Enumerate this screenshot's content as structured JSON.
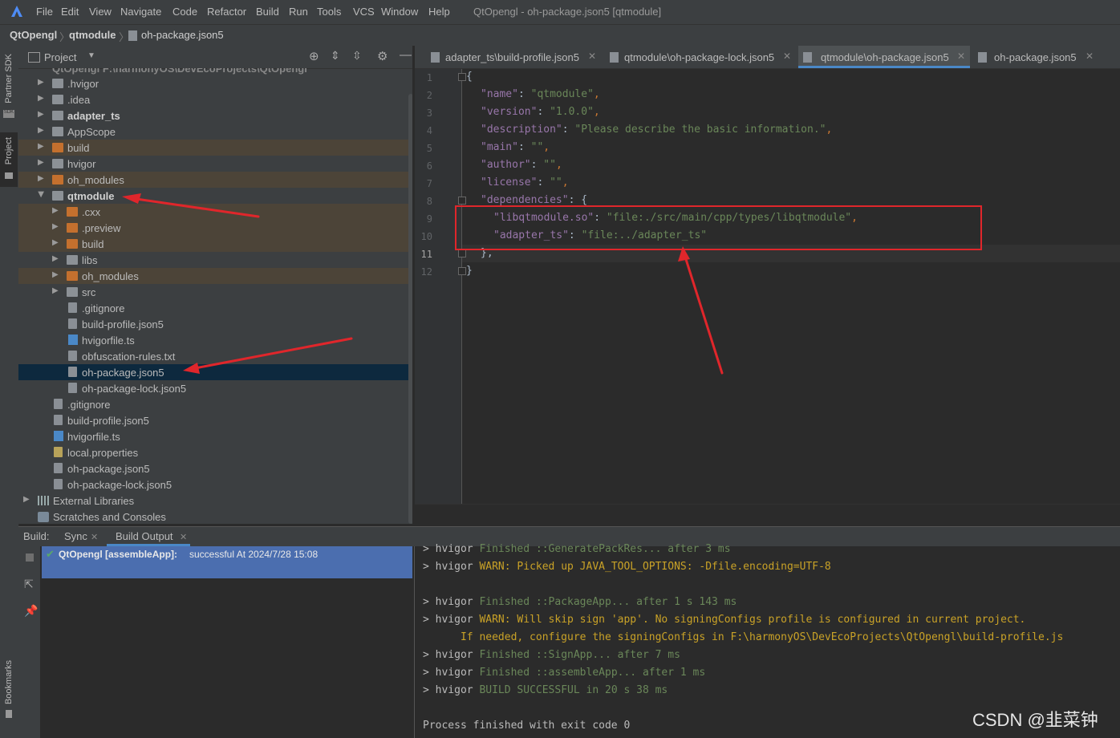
{
  "menubar": {
    "items": [
      "File",
      "Edit",
      "View",
      "Navigate",
      "Code",
      "Refactor",
      "Build",
      "Run",
      "Tools",
      "VCS",
      "Window",
      "Help"
    ],
    "window_title": "QtOpengl - oh-package.json5 [qtmodule]"
  },
  "breadcrumb": {
    "items": [
      "QtOpengl",
      "qtmodule",
      "oh-package.json5"
    ]
  },
  "left_strip": {
    "partner_sdk": "Partner SDK",
    "project": "Project",
    "bookmarks": "Bookmarks"
  },
  "project_panel": {
    "title": "Project",
    "root_partial": "QtOpengl  F:\\harmonyOS\\DevEcoProjects\\QtOpengl",
    "tree": [
      {
        "label": ".hvigor"
      },
      {
        "label": ".idea"
      },
      {
        "label": "adapter_ts"
      },
      {
        "label": "AppScope"
      },
      {
        "label": "build"
      },
      {
        "label": "hvigor"
      },
      {
        "label": "oh_modules"
      },
      {
        "label": "qtmodule"
      },
      {
        "label": ".cxx"
      },
      {
        "label": ".preview"
      },
      {
        "label": "build"
      },
      {
        "label": "libs"
      },
      {
        "label": "oh_modules"
      },
      {
        "label": "src"
      },
      {
        "label": ".gitignore"
      },
      {
        "label": "build-profile.json5"
      },
      {
        "label": "hvigorfile.ts"
      },
      {
        "label": "obfuscation-rules.txt"
      },
      {
        "label": "oh-package.json5"
      },
      {
        "label": "oh-package-lock.json5"
      },
      {
        "label": ".gitignore"
      },
      {
        "label": "build-profile.json5"
      },
      {
        "label": "hvigorfile.ts"
      },
      {
        "label": "local.properties"
      },
      {
        "label": "oh-package.json5"
      },
      {
        "label": "oh-package-lock.json5"
      },
      {
        "label": "External Libraries"
      },
      {
        "label": "Scratches and Consoles"
      }
    ]
  },
  "editor": {
    "tabs": [
      {
        "label": "adapter_ts\\build-profile.json5",
        "active": false
      },
      {
        "label": "qtmodule\\oh-package-lock.json5",
        "active": false
      },
      {
        "label": "qtmodule\\oh-package.json5",
        "active": true
      },
      {
        "label": "oh-package.json5",
        "active": false
      }
    ],
    "line_numbers": [
      "1",
      "2",
      "3",
      "4",
      "5",
      "6",
      "7",
      "8",
      "9",
      "10",
      "11",
      "12"
    ],
    "code": {
      "l1": "{",
      "l2_key": "\"name\"",
      "l2_val": "\"qtmodule\"",
      "l3_key": "\"version\"",
      "l3_val": "\"1.0.0\"",
      "l4_key": "\"description\"",
      "l4_val": "\"Please describe the basic information.\"",
      "l5_key": "\"main\"",
      "l5_val": "\"\"",
      "l6_key": "\"author\"",
      "l6_val": "\"\"",
      "l7_key": "\"license\"",
      "l7_val": "\"\"",
      "l8_key": "\"dependencies\"",
      "l8_rest": ": {",
      "l9_key": "\"libqtmodule.so\"",
      "l9_val": "\"file:./src/main/cpp/types/libqtmodule\"",
      "l10_key": "\"adapter_ts\"",
      "l10_val": "\"file:../adapter_ts\"",
      "l11": "},",
      "l12": "}"
    }
  },
  "build_panel": {
    "prefix": "Build:",
    "tabs": [
      "Sync",
      "Build Output"
    ],
    "result_name": "QtOpengl [assembleApp]:",
    "result_text": "successful At 2024/7/28 15:08",
    "output": {
      "o1_pre": "> hvigor ",
      "o1_msg": "Finished ::GeneratePackRes... after 3 ms",
      "o2_pre": "> hvigor ",
      "o2_msg": "WARN: Picked up JAVA_TOOL_OPTIONS: -Dfile.encoding=UTF-8",
      "o3_pre": "> hvigor ",
      "o3_msg": "Finished ::PackageApp... after 1 s 143 ms",
      "o4_pre": "> hvigor ",
      "o4_msg": "WARN: Will skip sign 'app'. No signingConfigs profile is configured in current project.",
      "o5_msg": "      If needed, configure the signingConfigs in F:\\harmonyOS\\DevEcoProjects\\QtOpengl\\build-profile.js",
      "o6_pre": "> hvigor ",
      "o6_msg": "Finished ::SignApp... after 7 ms",
      "o7_pre": "> hvigor ",
      "o7_msg": "Finished ::assembleApp... after 1 ms",
      "o8_pre": "> hvigor ",
      "o8_msg": "BUILD SUCCESSFUL in 20 s 38 ms",
      "o9": "Process finished with exit code 0"
    }
  },
  "watermark": "CSDN @韭菜钟",
  "colors": {
    "annotation": "#e0262b",
    "selection": "#4b6eaf"
  }
}
